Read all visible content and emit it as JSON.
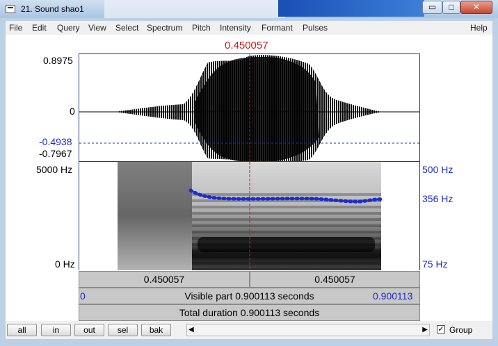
{
  "window": {
    "title": "21. Sound shao1",
    "controls": {
      "minimize": "▭",
      "maximize": "□",
      "close": "✕"
    }
  },
  "menu": [
    "File",
    "Edit",
    "Query",
    "View",
    "Select",
    "Spectrum",
    "Pitch",
    "Intensity",
    "Formant",
    "Pulses",
    "Help"
  ],
  "cursor_time": "0.450057",
  "waveform": {
    "y_max": "0.8975",
    "y_zero": "0",
    "y_cursor": "-0.4938",
    "y_min": "-0.7967"
  },
  "spectrogram": {
    "freq_top": "5000 Hz",
    "freq_bottom": "0 Hz"
  },
  "pitch": {
    "top": "500 Hz",
    "value": "356 Hz",
    "bottom": "75 Hz"
  },
  "time_bars": {
    "left_segment": "0.450057",
    "right_segment": "0.450057",
    "visible_start": "0",
    "visible_text": "Visible part 0.900113 seconds",
    "visible_end": "0.900113",
    "total_text": "Total duration 0.900113 seconds"
  },
  "buttons": {
    "all": "all",
    "in": "in",
    "out": "out",
    "sel": "sel",
    "bak": "bak"
  },
  "group": {
    "label": "Group",
    "checked": true,
    "mark": "✓"
  },
  "colors": {
    "cursor": "#d01818",
    "pitch": "#1b2bd0",
    "frame": "#1f3f7a"
  }
}
